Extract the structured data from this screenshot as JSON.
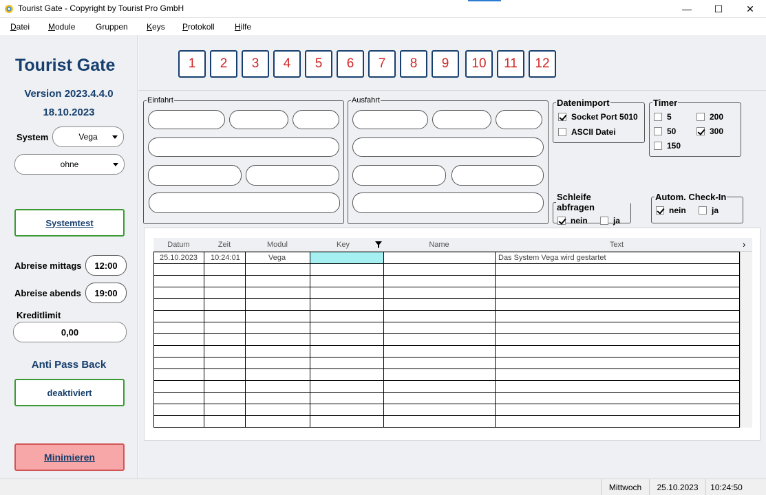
{
  "window": {
    "title": "Tourist Gate - Copyright by Tourist Pro GmbH",
    "minimize": "—",
    "maximize": "☐",
    "close": "✕"
  },
  "menu": [
    {
      "label": "Datei",
      "u": "D",
      "rest": "atei"
    },
    {
      "label": "Module",
      "u": "M",
      "rest": "odule"
    },
    {
      "label": "Gruppen",
      "u": "",
      "rest": "Gruppen"
    },
    {
      "label": "Keys",
      "u": "K",
      "rest": "eys"
    },
    {
      "label": "Protokoll",
      "u": "P",
      "rest": "rotokoll"
    },
    {
      "label": "Hilfe",
      "u": "H",
      "rest": "ilfe"
    }
  ],
  "sidebar": {
    "brand": "Tourist Gate",
    "version": "Version 2023.4.4.0",
    "date": "18.10.2023",
    "system_label": "System",
    "system_value": "Vega",
    "second_value": "ohne",
    "systemtest_label": "Systemtest",
    "abreise_mittags_label": "Abreise mittags",
    "abreise_mittags_value": "12:00",
    "abreise_abends_label": "Abreise abends",
    "abreise_abends_value": "19:00",
    "kreditlimit_label": "Kreditlimit",
    "kreditlimit_value": "0,00",
    "apb_label": "Anti Pass Back",
    "apb_button": "deaktiviert",
    "minimize_label": "Minimieren"
  },
  "gates": [
    "1",
    "2",
    "3",
    "4",
    "5",
    "6",
    "7",
    "8",
    "9",
    "10",
    "11",
    "12"
  ],
  "einfahrt": {
    "legend": "Einfahrt"
  },
  "ausfahrt": {
    "legend": "Ausfahrt"
  },
  "datenimport": {
    "legend": "Datenimport",
    "socket": {
      "label": "Socket Port 5010",
      "checked": true
    },
    "ascii": {
      "label": "ASCII Datei",
      "checked": false
    }
  },
  "timer": {
    "legend": "Timer",
    "options": [
      {
        "label": "5",
        "checked": false
      },
      {
        "label": "200",
        "checked": false
      },
      {
        "label": "50",
        "checked": false
      },
      {
        "label": "300",
        "checked": true
      },
      {
        "label": "150",
        "checked": false
      }
    ]
  },
  "schleife": {
    "legend": "Schleife abfragen",
    "nein": "nein",
    "ja": "ja",
    "nein_checked": true,
    "ja_checked": false
  },
  "checkin": {
    "legend": "Autom. Check-In",
    "nein": "nein",
    "ja": "ja",
    "nein_checked": true,
    "ja_checked": false
  },
  "table": {
    "columns": [
      "Datum",
      "Zeit",
      "Modul",
      "Key",
      "Name",
      "Text"
    ],
    "filter_icon": "filter-icon",
    "rows": [
      [
        "25.10.2023",
        "10:24:01",
        "Vega",
        "",
        "",
        "Das System Vega wird gestartet"
      ]
    ],
    "empty_rows": 14
  },
  "status": {
    "day": "Mittwoch",
    "date": "25.10.2023",
    "time": "10:24:50"
  }
}
